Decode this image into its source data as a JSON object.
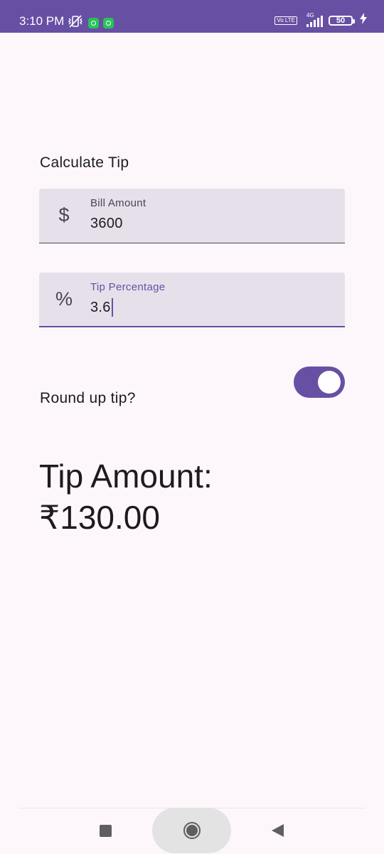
{
  "status_bar": {
    "time": "3:10 PM",
    "network_type": "4G",
    "volte_label": "Vo LTE",
    "battery_level": "50",
    "background_color": "#6750a4",
    "icons": [
      "vibrate-off-icon",
      "app-notification-icon",
      "app-notification-icon",
      "volte-icon",
      "signal-icon",
      "battery-icon",
      "charging-icon"
    ]
  },
  "form": {
    "heading": "Calculate Tip",
    "bill_amount": {
      "label": "Bill Amount",
      "value": "3600",
      "icon": "dollar-icon",
      "icon_glyph": "$"
    },
    "tip_percentage": {
      "label": "Tip Percentage",
      "value": "3.6",
      "icon": "percent-icon",
      "icon_glyph": "%",
      "focused": true
    },
    "round_up": {
      "label": "Round up tip?",
      "checked": true
    }
  },
  "result": {
    "label": "Tip Amount:",
    "amount": "₹130.00"
  },
  "navigation_bar": {
    "buttons": [
      "recent-apps-icon",
      "home-icon",
      "back-icon"
    ]
  },
  "colors": {
    "primary": "#6750a4",
    "field_background": "#e6e0eb",
    "page_background": "#fdf7fc",
    "text": "#1d1b20"
  }
}
